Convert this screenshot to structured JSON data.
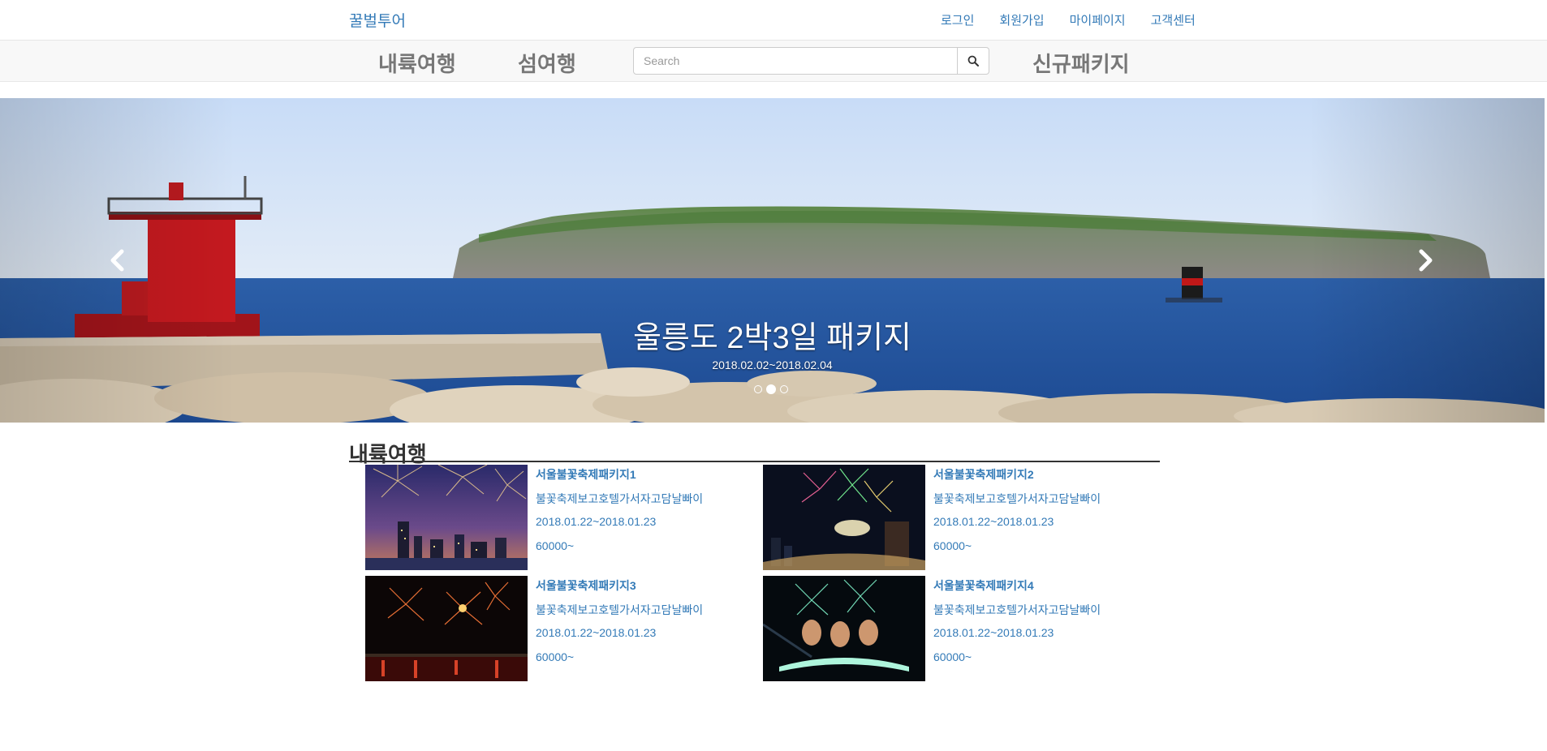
{
  "header": {
    "brand": "꿀벌투어",
    "links": [
      "로그인",
      "회원가입",
      "마이페이지",
      "고객센터"
    ]
  },
  "nav": {
    "domestic": "내륙여행",
    "island": "섬여행",
    "new_package": "신규패키지",
    "search_placeholder": "Search"
  },
  "carousel": {
    "title": "울릉도 2박3일 패키지",
    "date": "2018.02.02~2018.02.04",
    "slide_count": 3,
    "active_slide": 2
  },
  "section": {
    "title": "내륙여행",
    "items": [
      {
        "name": "서울불꽃축제패키지1",
        "desc": "불꽃축제보고호텔가서자고담날빠이",
        "date": "2018.01.22~2018.01.23",
        "price": "60000~"
      },
      {
        "name": "서울불꽃축제패키지2",
        "desc": "불꽃축제보고호텔가서자고담날빠이",
        "date": "2018.01.22~2018.01.23",
        "price": "60000~"
      },
      {
        "name": "서울불꽃축제패키지3",
        "desc": "불꽃축제보고호텔가서자고담날빠이",
        "date": "2018.01.22~2018.01.23",
        "price": "60000~"
      },
      {
        "name": "서울불꽃축제패키지4",
        "desc": "불꽃축제보고호텔가서자고담날빠이",
        "date": "2018.01.22~2018.01.23",
        "price": "60000~"
      }
    ]
  },
  "icons": {
    "search": "search-icon",
    "prev": "chevron-left-icon",
    "next": "chevron-right-icon"
  },
  "colors": {
    "link": "#337ab7",
    "nav_bg": "#f8f8f8",
    "nav_text": "#777777",
    "heading": "#333333"
  }
}
